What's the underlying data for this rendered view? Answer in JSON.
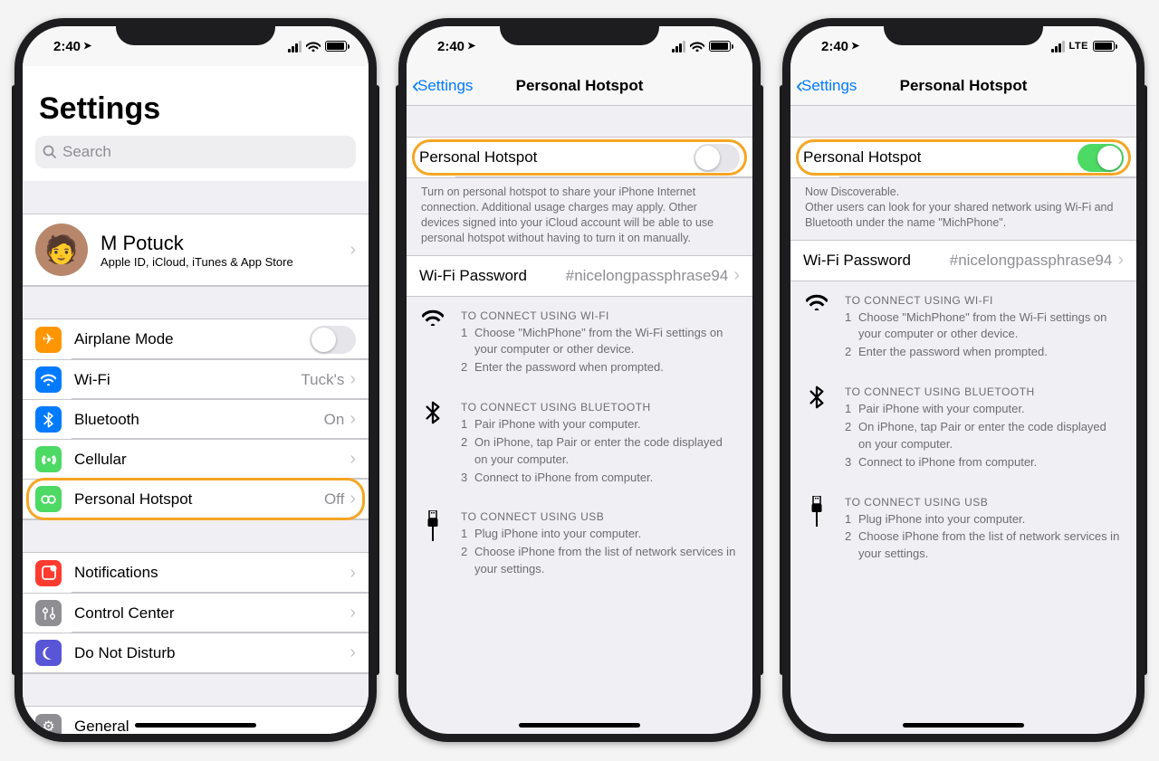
{
  "status": {
    "time": "2:40",
    "lte": "LTE"
  },
  "s1": {
    "titleLarge": "Settings",
    "searchPlaceholder": "Search",
    "profile": {
      "name": "M Potuck",
      "sub": "Apple ID, iCloud, iTunes & App Store"
    },
    "rows": {
      "airplane": "Airplane Mode",
      "wifi": "Wi-Fi",
      "wifi_val": "Tuck's",
      "bt": "Bluetooth",
      "bt_val": "On",
      "cell": "Cellular",
      "hotspot": "Personal Hotspot",
      "hotspot_val": "Off",
      "notif": "Notifications",
      "cc": "Control Center",
      "dnd": "Do Not Disturb",
      "general": "General"
    }
  },
  "detail": {
    "back": "Settings",
    "title": "Personal Hotspot",
    "rowLabel": "Personal Hotspot",
    "footOff": "Turn on personal hotspot to share your iPhone Internet connection. Additional usage charges may apply. Other devices signed into your iCloud account will be able to use personal hotspot without having to turn it on manually.",
    "footOn1": "Now Discoverable.",
    "footOn2": "Other users can look for your shared network using Wi-Fi and Bluetooth under the name \"MichPhone\".",
    "pwLabel": "Wi-Fi Password",
    "pwValue": "#nicelongpassphrase94",
    "wifiHead": "TO CONNECT USING WI-FI",
    "wifi1": "Choose \"MichPhone\" from the Wi-Fi settings on your computer or other device.",
    "wifi2": "Enter the password when prompted.",
    "btHead": "TO CONNECT USING BLUETOOTH",
    "bt1": "Pair iPhone with your computer.",
    "bt2": "On iPhone, tap Pair or enter the code displayed on your computer.",
    "bt3": "Connect to iPhone from computer.",
    "usbHead": "TO CONNECT USING USB",
    "usb1": "Plug iPhone into your computer.",
    "usb2": "Choose iPhone from the list of network services in your settings."
  }
}
